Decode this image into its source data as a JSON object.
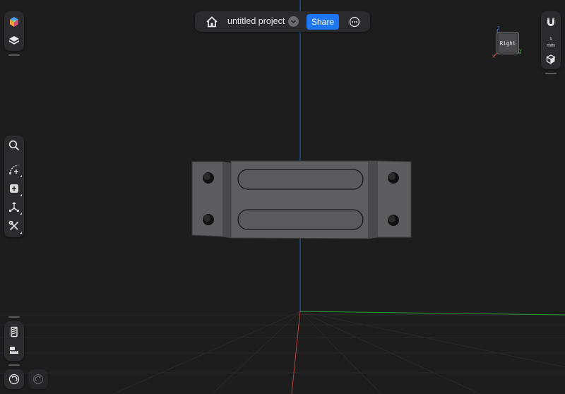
{
  "topbar": {
    "home_icon": "home-icon",
    "project_name": "untitled project",
    "share_label": "Share",
    "more_icon": "more-options-icon"
  },
  "left_top_tools": [
    "app-logo-icon",
    "layers-icon"
  ],
  "left_tools": [
    "search-icon",
    "sketch-icon",
    "add-primitive-icon",
    "transform-icon",
    "tools-icon"
  ],
  "left_bottom_tools": [
    "part-history-icon",
    "measure-icon"
  ],
  "history": [
    "undo-icon",
    "redo-icon"
  ],
  "right_tools": {
    "snap_icon": "magnet-icon",
    "units_value": "1",
    "units_label": "mm",
    "view_mode_icon": "view-cube-icon"
  },
  "viewcube": {
    "face_label": "Right",
    "axis_labels": [
      "Z",
      "X",
      "Y"
    ],
    "axis_colors": {
      "x": "#d9534f",
      "y": "#3fbf4a",
      "z": "#3e7be6"
    }
  },
  "colors": {
    "background": "#1d1d1e",
    "panel": "#2b2b2d",
    "accent": "#1f76f5",
    "grid": "#2a2a2b",
    "model_face": "#5b5b5d"
  }
}
